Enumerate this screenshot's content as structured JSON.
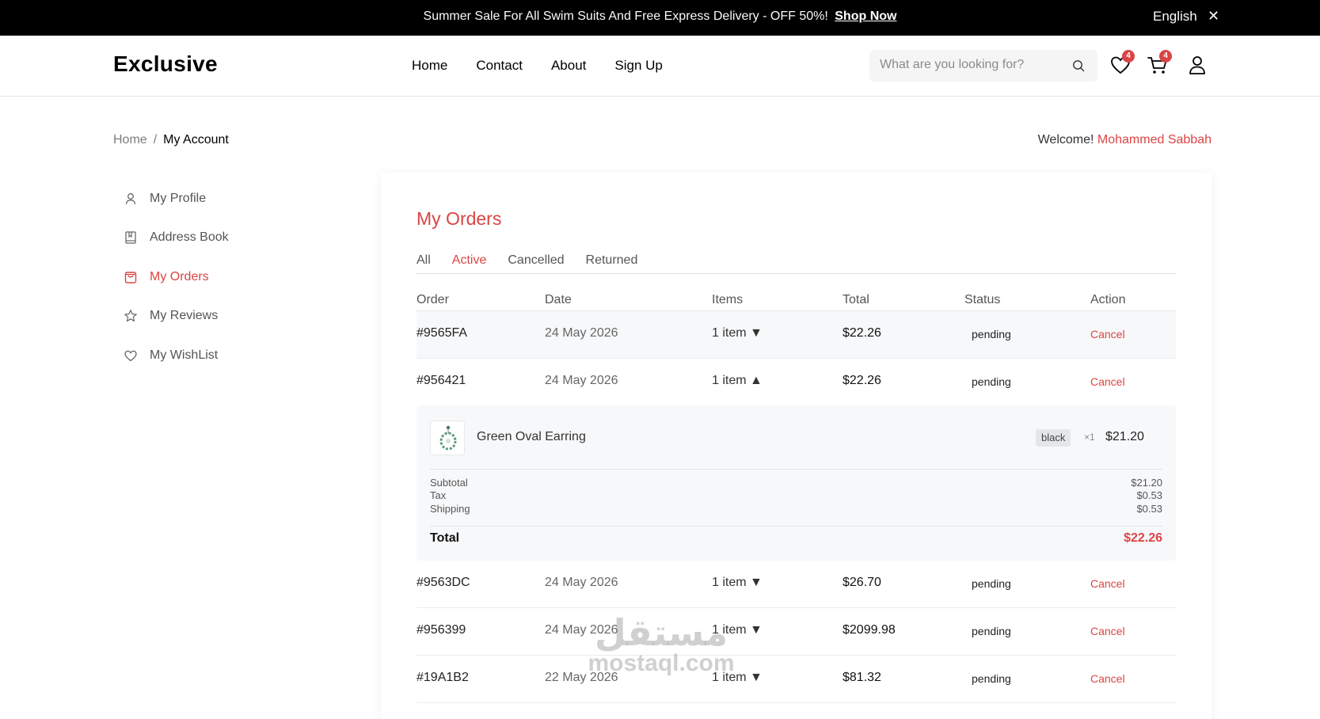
{
  "topbar": {
    "promo_text": "Summer Sale For All Swim Suits And Free Express Delivery - OFF 50%!",
    "promo_link": "Shop Now",
    "language": "English",
    "close_icon": "close-icon"
  },
  "header": {
    "logo": "Exclusive",
    "nav": [
      "Home",
      "Contact",
      "About",
      "Sign Up"
    ],
    "search_placeholder": "What are you looking for?",
    "wishlist_count": "4",
    "cart_count": "4"
  },
  "breadcrumb": {
    "home": "Home",
    "separator": "/",
    "current": "My Account"
  },
  "welcome": {
    "prefix": "Welcome!",
    "user_name": "Mohammed Sabbah"
  },
  "sidebar": {
    "items": [
      {
        "label": "My Profile",
        "icon": "user-icon"
      },
      {
        "label": "Address Book",
        "icon": "book-icon"
      },
      {
        "label": "My Orders",
        "icon": "bag-icon",
        "active": true
      },
      {
        "label": "My Reviews",
        "icon": "star-icon"
      },
      {
        "label": "My WishList",
        "icon": "heart-icon"
      }
    ]
  },
  "orders": {
    "title": "My Orders",
    "tabs": [
      "All",
      "Active",
      "Cancelled",
      "Returned"
    ],
    "active_tab": "Active",
    "columns": [
      "Order",
      "Date",
      "Items",
      "Total",
      "Status",
      "Action"
    ],
    "rows": [
      {
        "id": "#9565FA",
        "date": "24 May 2026",
        "items": "1 item",
        "toggle": "▼",
        "total": "$22.26",
        "status": "pending",
        "action": "Cancel"
      },
      {
        "id": "#956421",
        "date": "24 May 2026",
        "items": "1 item",
        "toggle": "▲",
        "total": "$22.26",
        "status": "pending",
        "action": "Cancel"
      },
      {
        "id": "#9563DC",
        "date": "24 May 2026",
        "items": "1 item",
        "toggle": "▼",
        "total": "$26.70",
        "status": "pending",
        "action": "Cancel"
      },
      {
        "id": "#956399",
        "date": "24 May 2026",
        "items": "1 item",
        "toggle": "▼",
        "total": "$2099.98",
        "status": "pending",
        "action": "Cancel"
      },
      {
        "id": "#19A1B2",
        "date": "22 May 2026",
        "items": "1 item",
        "toggle": "▼",
        "total": "$81.32",
        "status": "pending",
        "action": "Cancel"
      }
    ],
    "detail": {
      "product_name": "Green Oval Earring",
      "variant": "black",
      "quantity": "×1",
      "price": "$21.20",
      "subtotal_label": "Subtotal",
      "subtotal": "$21.20",
      "tax_label": "Tax",
      "tax": "$0.53",
      "shipping_label": "Shipping",
      "shipping": "$0.53",
      "total_label": "Total",
      "total": "$22.26"
    }
  },
  "watermark": {
    "arabic": "مستقل",
    "latin": "mostaql.com"
  },
  "colors": {
    "accent": "#db4444",
    "topbar": "#000000"
  }
}
